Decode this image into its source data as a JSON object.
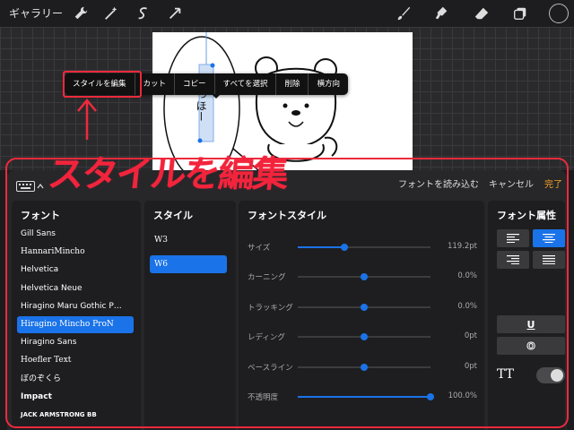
{
  "toolbar": {
    "gallery_label": "ギャラリー",
    "tools": [
      "wrench-icon",
      "magic-wand-icon",
      "selection-icon",
      "transform-arrow-icon",
      "brush-icon",
      "smudge-icon",
      "eraser-icon",
      "layers-icon"
    ]
  },
  "context_menu": {
    "items": [
      "スタイルを編集",
      "カット",
      "コピー",
      "すべてを選択",
      "削除",
      "横方向"
    ]
  },
  "canvas": {
    "vertical_text": "ひっほー"
  },
  "annotation": {
    "title": "スタイルを編集",
    "color": "#ee2a3d"
  },
  "panel": {
    "import_label": "フォントを読み込む",
    "cancel_label": "キャンセル",
    "done_label": "完了",
    "fonts_header": "フォント",
    "styles_header": "スタイル",
    "fontstyle_header": "フォントスタイル",
    "attrs_header": "フォント属性",
    "fonts": [
      "Gill Sans",
      "HannariMincho",
      "Helvetica",
      "Helvetica Neue",
      "Hiragino Maru Gothic P…",
      "Hiragino Mincho ProN",
      "Hiragino Sans",
      "Hoefler Text",
      "ぼのぞくら",
      "Impact",
      "JACK ARMSTRONG BB"
    ],
    "selected_font_index": 5,
    "styles": [
      "W3",
      "W6"
    ],
    "selected_style_index": 1,
    "sliders": [
      {
        "label": "サイズ",
        "value": "119.2pt",
        "level": 0.35,
        "filled": true
      },
      {
        "label": "カーニング",
        "value": "0.0%",
        "level": 0.5,
        "filled": false
      },
      {
        "label": "トラッキング",
        "value": "0.0%",
        "level": 0.5,
        "filled": false
      },
      {
        "label": "レディング",
        "value": "0pt",
        "level": 0.5,
        "filled": false
      },
      {
        "label": "ベースライン",
        "value": "0pt",
        "level": 0.5,
        "filled": false
      },
      {
        "label": "不透明度",
        "value": "100.0%",
        "level": 1.0,
        "filled": true
      }
    ],
    "underline_label": "U",
    "outline_label": "O",
    "tt_label": "TT",
    "accent_color": "#1a73e8"
  }
}
